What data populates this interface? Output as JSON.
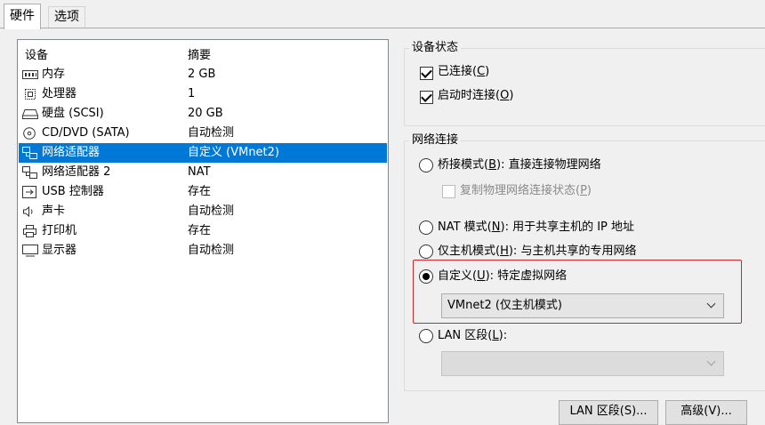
{
  "tabs": [
    {
      "label": "硬件"
    },
    {
      "label": "选项"
    }
  ],
  "device_list": {
    "columns": [
      "设备",
      "摘要"
    ],
    "rows": [
      {
        "icon": "memory-icon",
        "name": "内存",
        "summary": "2 GB"
      },
      {
        "icon": "processor-icon",
        "name": "处理器",
        "summary": "1"
      },
      {
        "icon": "harddisk-icon",
        "name": "硬盘 (SCSI)",
        "summary": "20 GB"
      },
      {
        "icon": "cd-dvd-icon",
        "name": "CD/DVD (SATA)",
        "summary": "自动检测"
      },
      {
        "icon": "network-adapter-icon",
        "name": "网络适配器",
        "summary": "自定义 (VMnet2)"
      },
      {
        "icon": "network-adapter-icon",
        "name": "网络适配器 2",
        "summary": "NAT"
      },
      {
        "icon": "usb-icon",
        "name": "USB 控制器",
        "summary": "存在"
      },
      {
        "icon": "sound-icon",
        "name": "声卡",
        "summary": "自动检测"
      },
      {
        "icon": "printer-icon",
        "name": "打印机",
        "summary": "存在"
      },
      {
        "icon": "display-icon",
        "name": "显示器",
        "summary": "自动检测"
      }
    ],
    "selected_index": 4
  },
  "device_status": {
    "title": "设备状态",
    "connected": {
      "text": "已连接(",
      "key": "C",
      "end": ")",
      "checked": true
    },
    "connect_at_power_on": {
      "text": "启动时连接(",
      "key": "O",
      "end": ")",
      "checked": true
    }
  },
  "network": {
    "title": "网络连接",
    "bridged": {
      "text": "桥接模式(",
      "key": "B",
      "end": "): 直接连接物理网络"
    },
    "replicate": {
      "text": "复制物理网络连接状态(",
      "key": "P",
      "end": ")"
    },
    "nat": {
      "text": "NAT 模式(",
      "key": "N",
      "end": "): 用于共享主机的 IP 地址"
    },
    "host_only": {
      "text": "仅主机模式(",
      "key": "H",
      "end": "): 与主机共享的专用网络"
    },
    "custom": {
      "text": "自定义(",
      "key": "U",
      "end": "): 特定虚拟网络"
    },
    "custom_select_value": "VMnet2 (仅主机模式)",
    "lan": {
      "text": "LAN 区段(",
      "key": "L",
      "end": "):"
    },
    "lan_select_value": "",
    "selected": "custom"
  },
  "buttons": {
    "lan_segments": "LAN 区段(S)...",
    "advanced": "高级(V)..."
  },
  "colors": {
    "selection": "#0078d7",
    "highlight_border": "#e02020"
  }
}
